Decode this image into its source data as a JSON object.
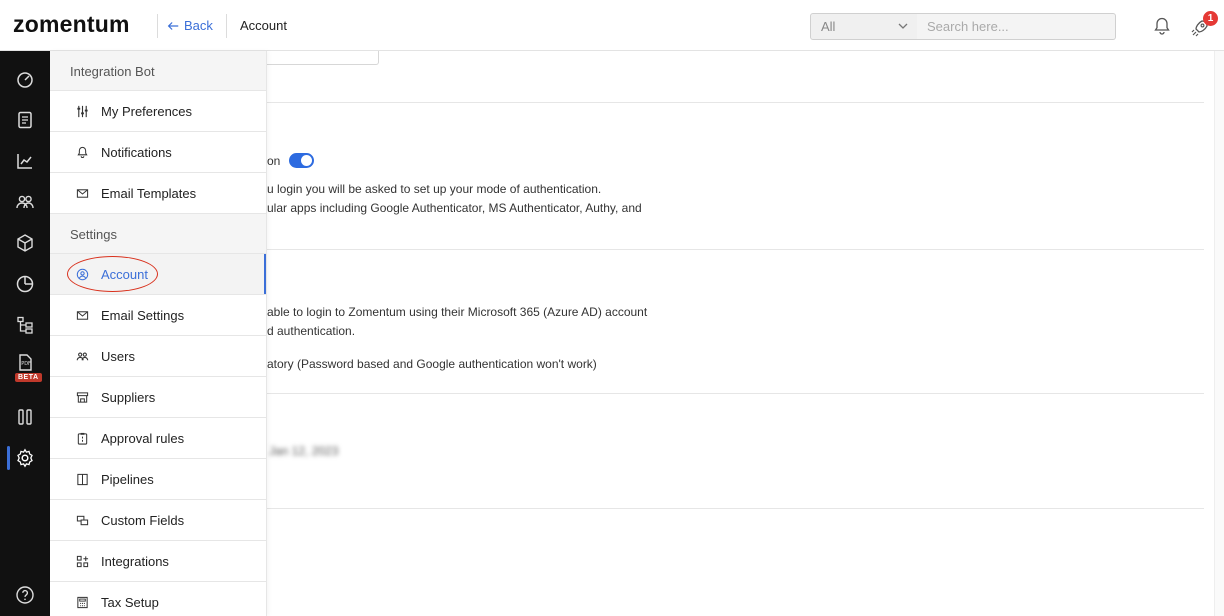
{
  "header": {
    "logo": "zomentum",
    "back_label": "Back",
    "breadcrumb": "Account",
    "filter_select": "All",
    "search_placeholder": "Search here...",
    "notification_badge": "1"
  },
  "rail": {
    "items": [
      "dashboard-icon",
      "document-icon",
      "chart-icon",
      "users-icon",
      "box-icon",
      "pie-icon",
      "hierarchy-icon",
      "pdf-icon",
      "columns-icon",
      "gear-icon",
      "help-icon"
    ],
    "beta_label": "BETA",
    "active": "gear-icon"
  },
  "menu": {
    "section_integration": "Integration Bot",
    "section_settings": "Settings",
    "items_top": [
      {
        "label": "My Preferences",
        "icon": "sliders-icon"
      },
      {
        "label": "Notifications",
        "icon": "bell-icon"
      },
      {
        "label": "Email Templates",
        "icon": "envelope-icon"
      }
    ],
    "items_settings": [
      {
        "label": "Account",
        "icon": "user-circle-icon",
        "active": true
      },
      {
        "label": "Email Settings",
        "icon": "envelope-icon"
      },
      {
        "label": "Users",
        "icon": "users-icon"
      },
      {
        "label": "Suppliers",
        "icon": "store-icon"
      },
      {
        "label": "Approval rules",
        "icon": "clipboard-icon"
      },
      {
        "label": "Pipelines",
        "icon": "columns-icon"
      },
      {
        "label": "Custom Fields",
        "icon": "fields-icon"
      },
      {
        "label": "Integrations",
        "icon": "grid-icon"
      },
      {
        "label": "Tax Setup",
        "icon": "calculator-icon"
      }
    ]
  },
  "content": {
    "toggle_label_fragment": "on",
    "mfa_line1": "u login you will be asked to set up your mode of authentication.",
    "mfa_line2": "ular apps including Google Authenticator, MS Authenticator, Authy, and",
    "azure_line1": "able to login to Zomentum using their Microsoft 365 (Azure AD) account",
    "azure_line2": "d authentication.",
    "azure_line3": "atory (Password based and Google authentication won't work)",
    "blurred_text": "Jan 12, 2023"
  },
  "colors": {
    "accent": "#3b6fd8",
    "rail_bg": "#111111",
    "badge": "#e53935",
    "annotation_circle": "#d9311d",
    "toggle_on": "#2d6be0"
  }
}
